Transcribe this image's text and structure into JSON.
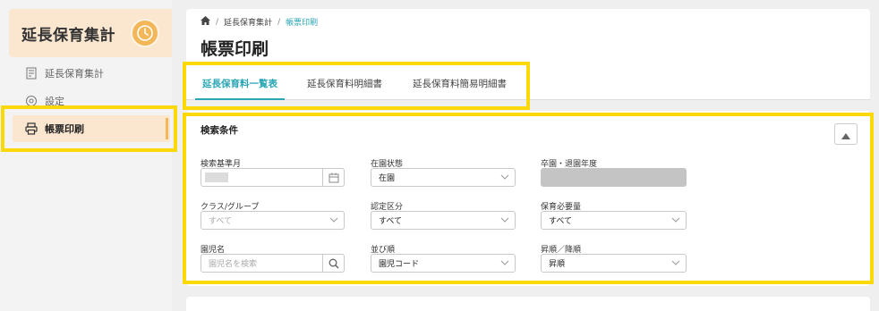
{
  "sidebar": {
    "app_title": "延長保育集計",
    "items": [
      {
        "label": "延長保育集計",
        "icon": "report-icon"
      },
      {
        "label": "設定",
        "icon": "settings-icon"
      },
      {
        "label": "帳票印刷",
        "icon": "printer-icon",
        "active": true
      }
    ]
  },
  "breadcrumb": {
    "items": [
      "延長保育集計",
      "帳票印刷"
    ]
  },
  "page_title": "帳票印刷",
  "tabs": [
    {
      "label": "延長保育料一覧表",
      "active": true
    },
    {
      "label": "延長保育料明細書"
    },
    {
      "label": "延長保育料簡易明細書"
    }
  ],
  "search": {
    "title": "検索条件",
    "fields": {
      "base_month": {
        "label": "検索基準月",
        "value": ""
      },
      "enrollment_status": {
        "label": "在園状態",
        "value": "在園"
      },
      "graduation_year": {
        "label": "卒園・退園年度",
        "value": ""
      },
      "class_group": {
        "label": "クラス/グループ",
        "placeholder": "すべて"
      },
      "certification": {
        "label": "認定区分",
        "value": "すべて"
      },
      "care_need": {
        "label": "保育必要量",
        "value": "すべて"
      },
      "child_name": {
        "label": "園児名",
        "placeholder": "園児名を検索"
      },
      "sort_by": {
        "label": "並び順",
        "value": "園児コード"
      },
      "sort_order": {
        "label": "昇順／降順",
        "value": "昇順"
      }
    }
  },
  "colors": {
    "accent": "#2aa6b5",
    "sidebar_active": "#fbe6cf",
    "logo": "#f3b75a",
    "highlight": "#fbd80a"
  }
}
